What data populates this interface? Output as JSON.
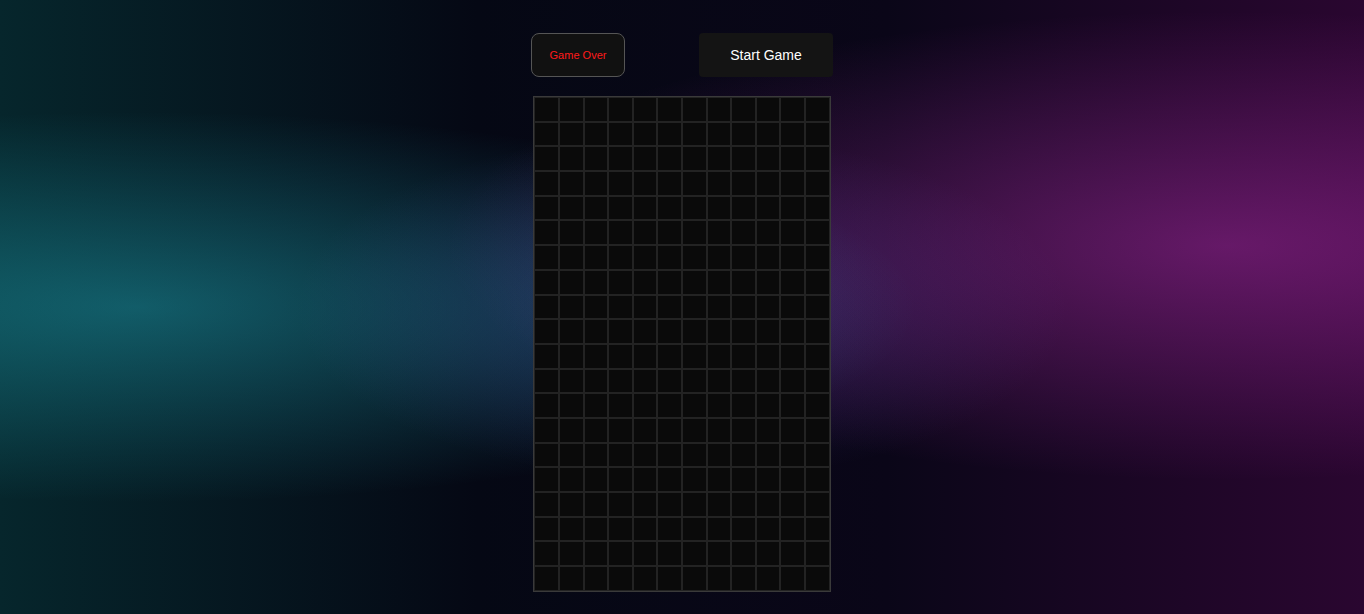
{
  "status": "Game Over",
  "start_button": "Start Game",
  "board": {
    "rows": [
      [
        0,
        0,
        0,
        0,
        0,
        0,
        0,
        0,
        0,
        0,
        0,
        0
      ],
      [
        0,
        0,
        0,
        0,
        0,
        0,
        0,
        0,
        0,
        0,
        0,
        0
      ],
      [
        0,
        0,
        0,
        0,
        0,
        0,
        0,
        0,
        0,
        0,
        0,
        0
      ],
      [
        0,
        0,
        0,
        0,
        0,
        0,
        0,
        0,
        0,
        0,
        0,
        0
      ],
      [
        0,
        0,
        0,
        0,
        0,
        0,
        0,
        0,
        0,
        0,
        0,
        0
      ],
      [
        0,
        0,
        0,
        0,
        0,
        0,
        0,
        0,
        0,
        0,
        0,
        0
      ],
      [
        0,
        0,
        0,
        0,
        0,
        0,
        0,
        0,
        0,
        0,
        0,
        0
      ],
      [
        0,
        0,
        0,
        0,
        0,
        0,
        0,
        0,
        0,
        0,
        0,
        0
      ],
      [
        0,
        0,
        0,
        0,
        0,
        0,
        0,
        0,
        0,
        0,
        0,
        0
      ],
      [
        0,
        0,
        0,
        0,
        0,
        0,
        0,
        0,
        0,
        0,
        0,
        0
      ],
      [
        0,
        0,
        0,
        0,
        0,
        0,
        0,
        0,
        0,
        0,
        0,
        0
      ],
      [
        0,
        0,
        0,
        0,
        0,
        0,
        0,
        0,
        0,
        0,
        0,
        0
      ],
      [
        0,
        0,
        0,
        0,
        0,
        0,
        0,
        0,
        0,
        0,
        0,
        0
      ],
      [
        0,
        0,
        0,
        0,
        0,
        0,
        0,
        0,
        0,
        0,
        0,
        0
      ],
      [
        0,
        0,
        0,
        0,
        0,
        0,
        0,
        0,
        0,
        0,
        0,
        0
      ],
      [
        0,
        0,
        0,
        0,
        0,
        0,
        0,
        0,
        0,
        0,
        0,
        0
      ],
      [
        0,
        0,
        0,
        0,
        0,
        0,
        0,
        0,
        0,
        0,
        0,
        0
      ],
      [
        0,
        0,
        0,
        0,
        0,
        0,
        0,
        0,
        0,
        0,
        0,
        0
      ],
      [
        0,
        0,
        0,
        0,
        0,
        0,
        0,
        0,
        0,
        0,
        0,
        0
      ],
      [
        0,
        0,
        0,
        0,
        0,
        0,
        0,
        0,
        0,
        0,
        0,
        0
      ]
    ]
  }
}
